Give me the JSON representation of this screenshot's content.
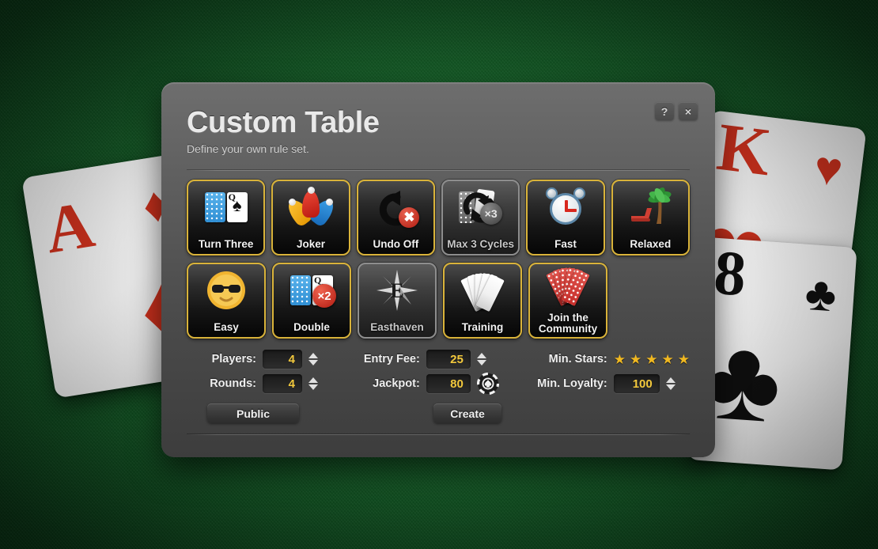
{
  "dialog": {
    "title": "Custom Table",
    "subtitle": "Define your own rule set.",
    "help_label": "?",
    "close_label": "×"
  },
  "options_row_1": [
    {
      "label": "Turn Three",
      "icon": "playing-cards-icon",
      "selected": true
    },
    {
      "label": "Joker",
      "icon": "joker-hat-icon",
      "selected": true
    },
    {
      "label": "Undo Off",
      "icon": "undo-disabled-icon",
      "selected": true
    },
    {
      "label": "Max 3 Cycles",
      "icon": "recycle-x3-icon",
      "selected": false
    },
    {
      "label": "Fast",
      "icon": "alarm-clock-icon",
      "selected": true
    },
    {
      "label": "Relaxed",
      "icon": "palm-lounger-icon",
      "selected": true
    }
  ],
  "options_row_2": [
    {
      "label": "Easy",
      "icon": "sunglasses-sun-icon",
      "selected": true
    },
    {
      "label": "Double",
      "icon": "double-deck-icon",
      "selected": true
    },
    {
      "label": "Easthaven",
      "icon": "compass-east-icon",
      "selected": false
    },
    {
      "label": "Training",
      "icon": "card-fan-icon",
      "selected": true
    },
    {
      "label": "Join the Community",
      "icon": "community-fan-icon",
      "selected": true
    }
  ],
  "fields": {
    "players": {
      "label": "Players:",
      "value": "4"
    },
    "rounds": {
      "label": "Rounds:",
      "value": "4"
    },
    "entry_fee": {
      "label": "Entry Fee:",
      "value": "25"
    },
    "jackpot": {
      "label": "Jackpot:",
      "value": "80"
    },
    "min_stars": {
      "label": "Min. Stars:",
      "count": 5,
      "glyph": "★"
    },
    "min_loyalty": {
      "label": "Min. Loyalty:",
      "value": "100"
    }
  },
  "buttons": {
    "public": "Public",
    "create": "Create"
  },
  "background_cards": [
    {
      "name": "ace-of-diamonds",
      "rank": "A",
      "pip": "♦",
      "color": "red"
    },
    {
      "name": "king-of-hearts",
      "rank": "K",
      "pip": "♥",
      "color": "red"
    },
    {
      "name": "eight-of-clubs",
      "rank": "8",
      "pip": "♣",
      "color": "black"
    }
  ],
  "colors": {
    "felt": "#17642a",
    "panel": "#5f5f5f",
    "tile_selected_border": "#d9b33a",
    "tile_unselected_border": "#8e8e8e",
    "value_text": "#f2c83c",
    "star": "#f0b821"
  },
  "tile_labels": {
    "r1c1": "Turn Three",
    "r1c2": "Joker",
    "r1c3": "Undo Off",
    "r1c4": "Max 3 Cycles",
    "r1c5": "Fast",
    "r1c6": "Relaxed",
    "r2c1": "Easy",
    "r2c2": "Double",
    "r2c3": "Easthaven",
    "r2c4": "Training",
    "r2c5a": "Join the",
    "r2c5b": "Community"
  }
}
